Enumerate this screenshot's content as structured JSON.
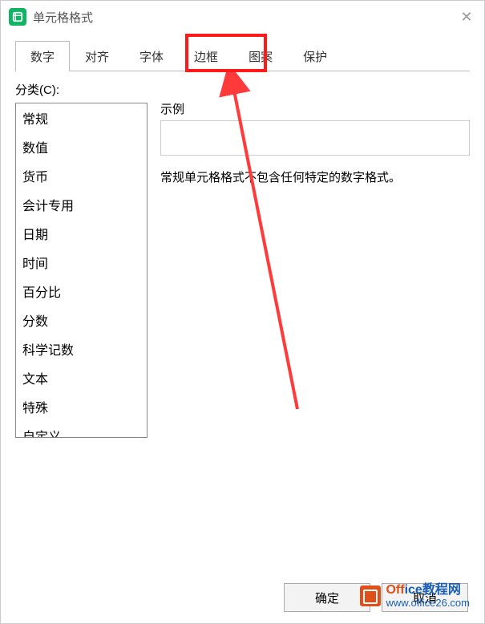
{
  "window": {
    "title": "单元格格式"
  },
  "tabs": {
    "items": [
      "数字",
      "对齐",
      "字体",
      "边框",
      "图案",
      "保护"
    ],
    "active_index": 0,
    "highlighted_index": 3
  },
  "category": {
    "label": "分类(C):",
    "items": [
      "常规",
      "数值",
      "货币",
      "会计专用",
      "日期",
      "时间",
      "百分比",
      "分数",
      "科学记数",
      "文本",
      "特殊",
      "自定义"
    ]
  },
  "sample": {
    "label": "示例",
    "value": ""
  },
  "description": "常规单元格格式不包含任何特定的数字格式。",
  "buttons": {
    "ok": "确定",
    "cancel": "取消"
  },
  "watermark": {
    "brand_prefix": "Off",
    "brand_suffix": "ice教程网",
    "url": "www.office26.com"
  },
  "annotation": {
    "highlight_color": "#ff1a1a",
    "arrow_color": "#ff3a3a"
  }
}
